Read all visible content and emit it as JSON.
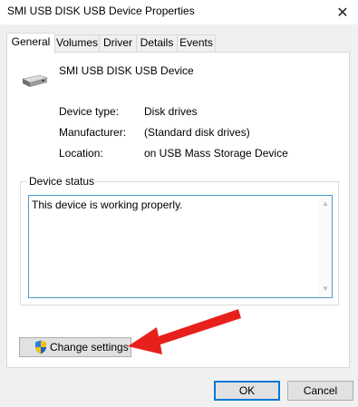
{
  "window": {
    "title": "SMI USB DISK USB Device Properties",
    "close_glyph": "✕"
  },
  "tabs": [
    {
      "label": "General",
      "active": true
    },
    {
      "label": "Volumes",
      "active": false
    },
    {
      "label": "Driver",
      "active": false
    },
    {
      "label": "Details",
      "active": false
    },
    {
      "label": "Events",
      "active": false
    }
  ],
  "device": {
    "name": "SMI USB DISK USB Device",
    "icon": "disk-drive-icon",
    "properties": [
      {
        "label": "Device type:",
        "value": "Disk drives"
      },
      {
        "label": "Manufacturer:",
        "value": "(Standard disk drives)"
      },
      {
        "label": "Location:",
        "value": "on USB Mass Storage Device"
      }
    ]
  },
  "status": {
    "group_label": "Device status",
    "text": "This device is working properly."
  },
  "change_settings": {
    "label": "Change settings",
    "icon": "uac-shield-icon"
  },
  "footer": {
    "ok_label": "OK",
    "cancel_label": "Cancel"
  },
  "colors": {
    "window_bg": "#f0f0f0",
    "panel_bg": "#ffffff",
    "focus_border": "#0078d7",
    "annotation_arrow": "#e8201c"
  }
}
